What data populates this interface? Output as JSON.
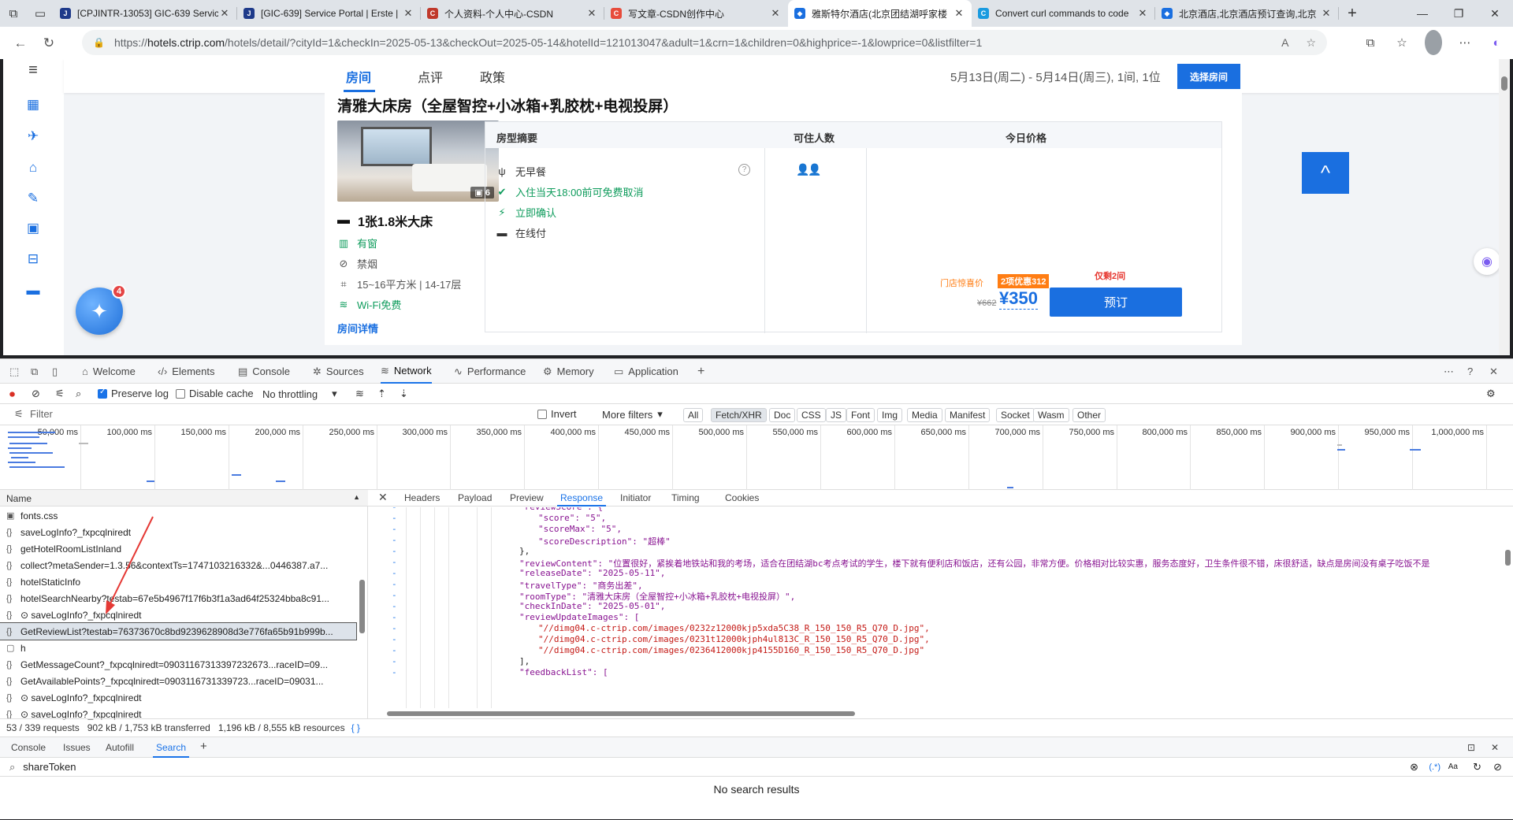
{
  "browser": {
    "tabs": [
      {
        "title": "[CPJINTR-13053] GIC-639 Servic",
        "color": "#1e3a8a",
        "glyph": "J"
      },
      {
        "title": "[GIC-639] Service Portal | Erste |",
        "color": "#1e3a8a",
        "glyph": "J"
      },
      {
        "title": "个人资料-个人中心-CSDN",
        "color": "#c0392b",
        "glyph": "C"
      },
      {
        "title": "写文章-CSDN创作中心",
        "color": "#e74c3c",
        "glyph": "C"
      },
      {
        "title": "雅斯特尔酒店(北京团结湖呼家楼",
        "color": "#1a6fe0",
        "glyph": "◆"
      },
      {
        "title": "Convert curl commands to code",
        "color": "#1a9be0",
        "glyph": "C"
      },
      {
        "title": "北京酒店,北京酒店预订查询,北京",
        "color": "#1a6fe0",
        "glyph": "◆"
      }
    ],
    "active_tab": 4,
    "url_prefix": "https://",
    "url_host": "hotels.ctrip.com",
    "url_rest": "/hotels/detail/?cityId=1&checkIn=2025-05-13&checkOut=2025-05-14&hotelId=121013047&adult=1&crn=1&children=0&highprice=-1&lowprice=0&listfilter=1"
  },
  "site": {
    "nav": {
      "rooms": "房间",
      "reviews": "点评",
      "policy": "政策"
    },
    "dates": "5月13日(周二) - 5月14日(周三), 1间, 1位",
    "choose_room": "选择房间",
    "bird_badge": "4",
    "room": {
      "title": "清雅大床房（全屋智控+小冰箱+乳胶枕+电视投屏）",
      "photo_count": "6",
      "bed": "1张1.8米大床",
      "window": "有窗",
      "smoking": "禁烟",
      "area": "15~16平方米 | 14-17层",
      "wifi": "Wi-Fi免费",
      "detail_link": "房间详情"
    },
    "table": {
      "col_summary": "房型摘要",
      "col_guests": "可住人数",
      "col_price": "今日价格",
      "breakfast": "无早餐",
      "cancel": "入住当天18:00前可免费取消",
      "confirm": "立即确认",
      "pay": "在线付",
      "guests_icon": "👤👤",
      "remain": "仅剩2间",
      "promo_label": "门店惊喜价",
      "promo_badge": "2项优惠312",
      "old_price": "¥662",
      "price": "¥350",
      "book": "预订"
    }
  },
  "devtools": {
    "tabs": [
      "Welcome",
      "Elements",
      "Console",
      "Sources",
      "Network",
      "Performance",
      "Memory",
      "Application"
    ],
    "active_tab": "Network",
    "toolbar": {
      "preserve_log": "Preserve log",
      "disable_cache": "Disable cache",
      "throttling": "No throttling"
    },
    "filter": {
      "placeholder": "Filter",
      "invert": "Invert",
      "more_filters": "More filters"
    },
    "type_filters": [
      "All",
      "Fetch/XHR",
      "Doc",
      "CSS",
      "JS",
      "Font",
      "Img",
      "Media",
      "Manifest",
      "Socket",
      "Wasm",
      "Other"
    ],
    "active_type_filter": "Fetch/XHR",
    "timeline_ticks": [
      "50,000 ms",
      "100,000 ms",
      "150,000 ms",
      "200,000 ms",
      "250,000 ms",
      "300,000 ms",
      "350,000 ms",
      "400,000 ms",
      "450,000 ms",
      "500,000 ms",
      "550,000 ms",
      "600,000 ms",
      "650,000 ms",
      "700,000 ms",
      "750,000 ms",
      "800,000 ms",
      "850,000 ms",
      "900,000 ms",
      "950,000 ms",
      "1,000,000 ms"
    ],
    "name_header": "Name",
    "requests": [
      {
        "icon": "▣",
        "name": "fonts.css"
      },
      {
        "icon": "{}",
        "name": "saveLogInfo?_fxpcqlniredt"
      },
      {
        "icon": "{}",
        "name": "getHotelRoomListInland"
      },
      {
        "icon": "{}",
        "name": "collect?metaSender=1.3.56&contextTs=1747103216332&...0446387.a7..."
      },
      {
        "icon": "{}",
        "name": "hotelStaticInfo"
      },
      {
        "icon": "{}",
        "name": "hotelSearchNearby?testab=67e5b4967f17f6b3f1a3ad64f25324bba8c91..."
      },
      {
        "icon": "{}",
        "name": "⊙ saveLogInfo?_fxpcqlniredt"
      },
      {
        "icon": "{}",
        "name": "GetReviewList?testab=76373670c8bd9239628908d3e776fa65b91b999b..."
      },
      {
        "icon": "▢",
        "name": "h"
      },
      {
        "icon": "{}",
        "name": "GetMessageCount?_fxpcqlniredt=09031167313397232673...raceID=09..."
      },
      {
        "icon": "{}",
        "name": "GetAvailablePoints?_fxpcqlniredt=0903116731339723...raceID=09031..."
      },
      {
        "icon": "{}",
        "name": "⊙ saveLogInfo?_fxpcqlniredt"
      },
      {
        "icon": "{}",
        "name": "⊙ saveLogInfo?_fxpcqlniredt"
      }
    ],
    "selected_request": 7,
    "detail_tabs": [
      "Headers",
      "Payload",
      "Preview",
      "Response",
      "Initiator",
      "Timing",
      "Cookies"
    ],
    "active_detail_tab": "Response",
    "response_lines": [
      {
        "gut": "-",
        "text": "\"reviewScore\": {",
        "indent": 0
      },
      {
        "gut": "-",
        "text": "\"score\": \"5\",",
        "indent": 1
      },
      {
        "gut": "-",
        "text": "\"scoreMax\": \"5\",",
        "indent": 1
      },
      {
        "gut": "-",
        "text": "\"scoreDescription\": \"超棒\"",
        "indent": 1
      },
      {
        "gut": "-",
        "text": "},",
        "indent": 0
      },
      {
        "gut": "-",
        "text": "\"reviewContent\": \"位置很好，紧挨着地铁站和我的考场，适合在团结湖bc考点考试的学生，楼下就有便利店和饭店，还有公园，非常方便。价格相对比较实惠，服务态度好，卫生条件很不错，床很舒适，缺点是房间没有桌子吃饭不是",
        "indent": 0
      },
      {
        "gut": "-",
        "text": "\"releaseDate\": \"2025-05-11\",",
        "indent": 0
      },
      {
        "gut": "-",
        "text": "\"travelType\": \"商务出差\",",
        "indent": 0
      },
      {
        "gut": "-",
        "text": "\"roomType\": \"清雅大床房（全屋智控+小冰箱+乳胶枕+电视投屏）\",",
        "indent": 0
      },
      {
        "gut": "-",
        "text": "\"checkInDate\": \"2025-05-01\",",
        "indent": 0
      },
      {
        "gut": "-",
        "text": "\"reviewUpdateImages\": [",
        "indent": 0
      },
      {
        "gut": "-",
        "text": "\"//dimg04.c-ctrip.com/images/0232z12000kjp5xda5C38_R_150_150_R5_Q70_D.jpg\",",
        "indent": 1
      },
      {
        "gut": "-",
        "text": "\"//dimg04.c-ctrip.com/images/0231t12000kjph4ul813C_R_150_150_R5_Q70_D.jpg\",",
        "indent": 1
      },
      {
        "gut": "-",
        "text": "\"//dimg04.c-ctrip.com/images/0236412000kjp4155D160_R_150_150_R5_Q70_D.jpg\"",
        "indent": 1
      },
      {
        "gut": "-",
        "text": "],",
        "indent": 0
      },
      {
        "gut": "-",
        "text": "\"feedbackList\": [",
        "indent": 0
      }
    ],
    "status": "53 / 339 requests   902 kB / 1,753 kB transferred   1,196 kB / 8,555 kB resources",
    "drawer_tabs": [
      "Console",
      "Issues",
      "Autofill",
      "Search"
    ],
    "active_drawer_tab": "Search",
    "search_query": "shareToken",
    "search_result": "No search results"
  }
}
